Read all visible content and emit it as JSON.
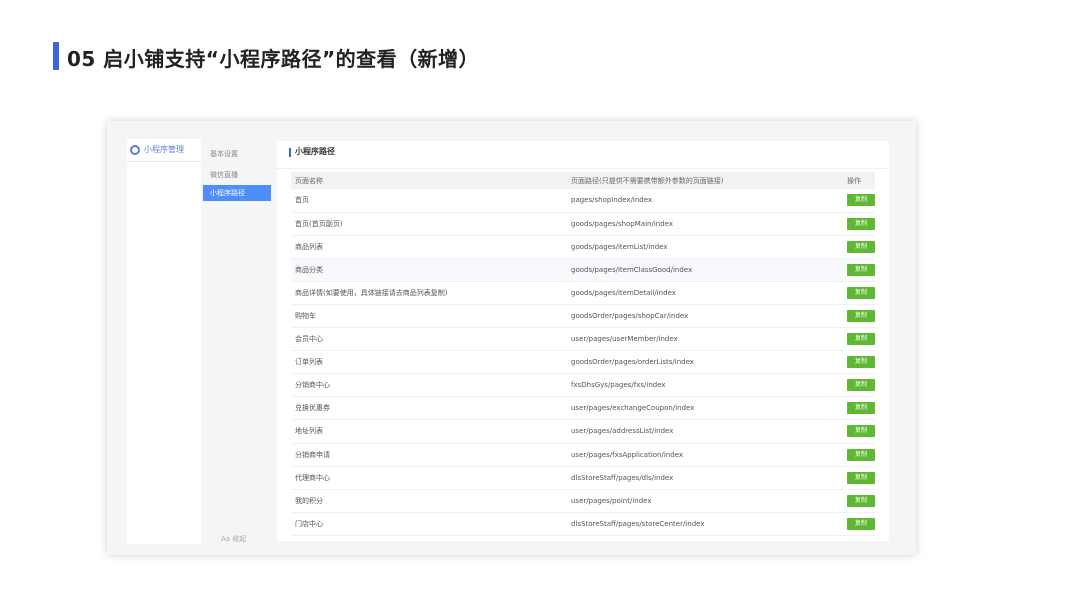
{
  "slide": {
    "title": "05 启小铺支持“小程序路径”的查看（新增）"
  },
  "app": {
    "name": "小程序管理",
    "logo_icon": "logo-ring-icon"
  },
  "sub_menu": {
    "items": [
      {
        "label": "基本设置"
      },
      {
        "label": "微信直播"
      },
      {
        "label": "小程序路径"
      }
    ],
    "active_index": 2,
    "footer": "Aa  收起"
  },
  "panel": {
    "title": "小程序路径",
    "columns": {
      "name": "页面名称",
      "path": "页面路径(只提供不需要携带额外参数的页面链接)",
      "action": "操作"
    },
    "copy_label": "复制",
    "rows": [
      {
        "name": "首页",
        "path": "pages/shopIndex/index"
      },
      {
        "name": "首页(首页副页)",
        "path": "goods/pages/shopMain/index"
      },
      {
        "name": "商品列表",
        "path": "goods/pages/itemList/index"
      },
      {
        "name": "商品分类",
        "path": "goods/pages/itemClassGood/index"
      },
      {
        "name": "商品详情(如要使用，具体链接请去商品列表复制)",
        "path": "goods/pages/itemDetail/index"
      },
      {
        "name": "购物车",
        "path": "goodsOrder/pages/shopCar/index"
      },
      {
        "name": "会员中心",
        "path": "user/pages/userMember/index"
      },
      {
        "name": "订单列表",
        "path": "goodsOrder/pages/orderLists/index"
      },
      {
        "name": "分销商中心",
        "path": "fxsDhsGys/pages/fxs/index"
      },
      {
        "name": "兑换优惠券",
        "path": "user/pages/exchangeCoupon/index"
      },
      {
        "name": "地址列表",
        "path": "user/pages/addressList/index"
      },
      {
        "name": "分销商申请",
        "path": "user/pages/fxsApplication/index"
      },
      {
        "name": "代理商中心",
        "path": "dlsStoreStaff/pages/dls/index"
      },
      {
        "name": "我的积分",
        "path": "user/pages/point/index"
      },
      {
        "name": "门店中心",
        "path": "dlsStoreStaff/pages/storeCenter/index"
      }
    ]
  },
  "colors": {
    "accent": "#3d63dd",
    "menu_active": "#4f8ef7",
    "copy_button": "#5fb832"
  }
}
